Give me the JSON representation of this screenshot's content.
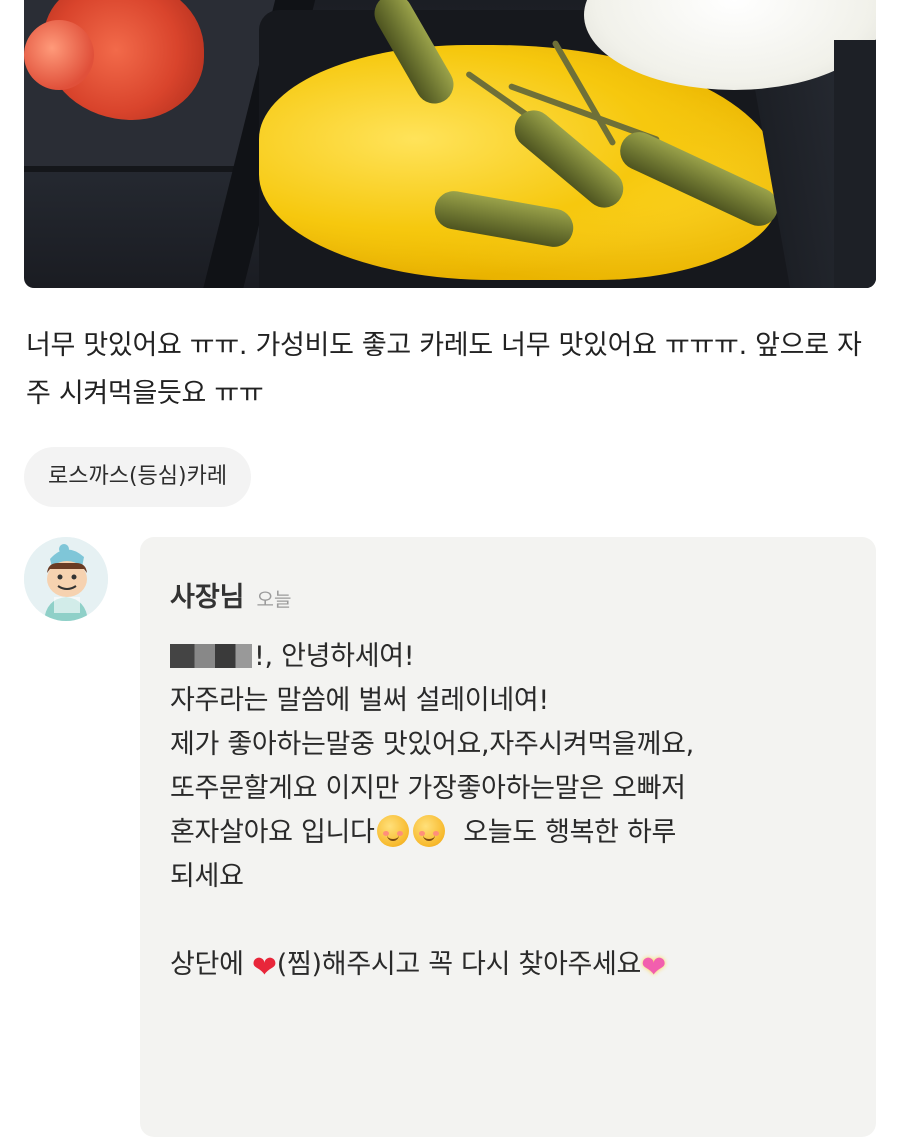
{
  "review": {
    "text": "너무 맛있어요 ㅠㅠ. 가성비도 좋고 카레도 너무 맛있어요 ㅠㅠㅠ. 앞으로 자주 시켜먹을듯요 ㅠㅠ",
    "menu_tag": "로스까스(등심)카레"
  },
  "reply": {
    "owner_name": "사장님",
    "date": "오늘",
    "greeting": "!, 안녕하세여!",
    "lines": [
      "자주라는 말씀에 벌써 설레이네여!",
      "제가 좋아하는말중 맛있어요,자주시켜먹을께요,",
      "또주문할게요 이지만 가장좋아하는말은 오빠저",
      "혼자살아요 입니다",
      "오늘도 행복한 하루",
      "되세요",
      "상단에",
      "(찜)해주시고 꼭 다시 찾아주세요"
    ]
  },
  "icons": {
    "smile_emoji": "smiling-face-emoji",
    "heart_emoji": "red-heart-emoji",
    "sparkling_heart": "sparkling-heart-emoji"
  },
  "colors": {
    "reply_bg": "#f3f3f1",
    "tag_bg": "#f3f3f3",
    "date_gray": "#9b9b9b"
  }
}
